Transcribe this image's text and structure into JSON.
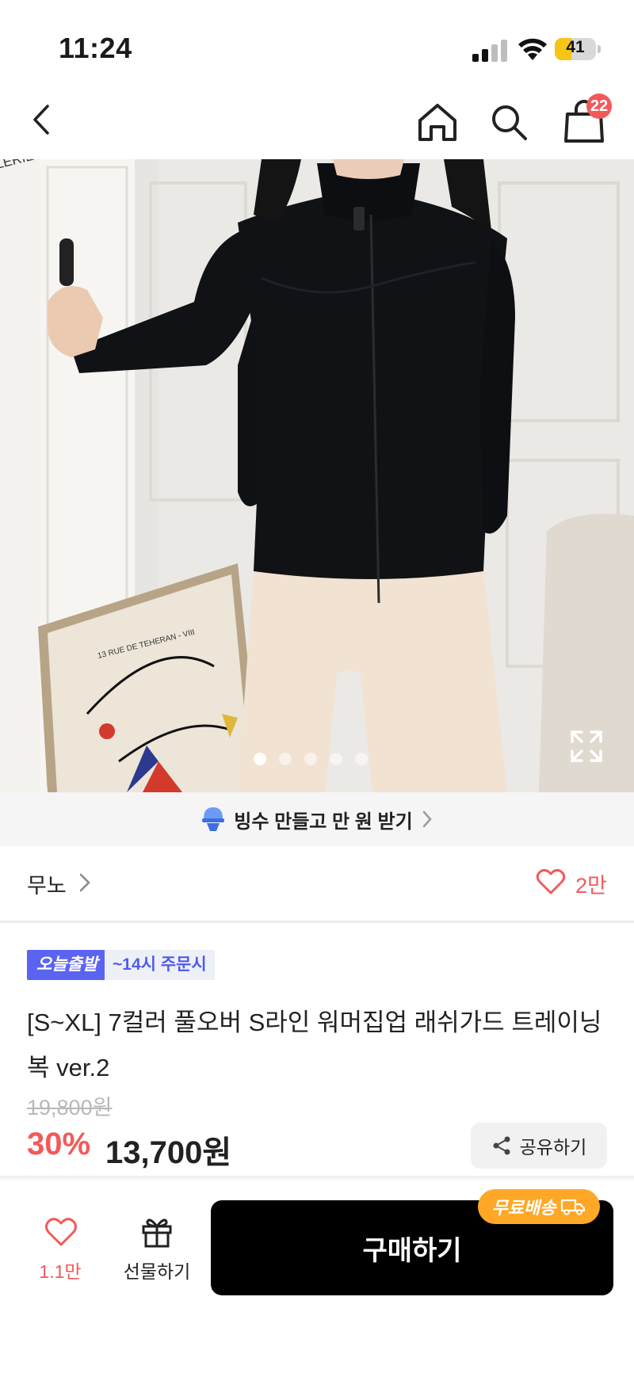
{
  "status_bar": {
    "time": "11:24",
    "battery": "41",
    "battery_level": 0.41
  },
  "nav": {
    "cart_count": "22"
  },
  "hero": {
    "poster_line1": "GALERIE  MAEGHT",
    "poster_line2": "13 RUE DE TEHERAN - VIII",
    "slide_count": 5,
    "active_slide": 1
  },
  "promo": {
    "text": "빙수 만들고 만 원 받기"
  },
  "brand": {
    "name": "무노",
    "likes": "2만"
  },
  "product": {
    "badge_today": "오늘출발",
    "badge_order": "~14시 주문시",
    "title": "[S~XL] 7컬러 풀오버 S라인 워머집업 래쉬가드 트레이닝복 ver.2",
    "original_price": "19,800원",
    "discount": "30%",
    "price": "13,700원",
    "share_label": "공유하기"
  },
  "bottom_bar": {
    "like_count": "1.1만",
    "gift_label": "선물하기",
    "buy_label": "구매하기",
    "free_shipping": "무료배송"
  },
  "colors": {
    "accent_red": "#f25a5a",
    "badge_blue": "#5b64f0",
    "orange": "#ffa726",
    "black": "#000000"
  }
}
